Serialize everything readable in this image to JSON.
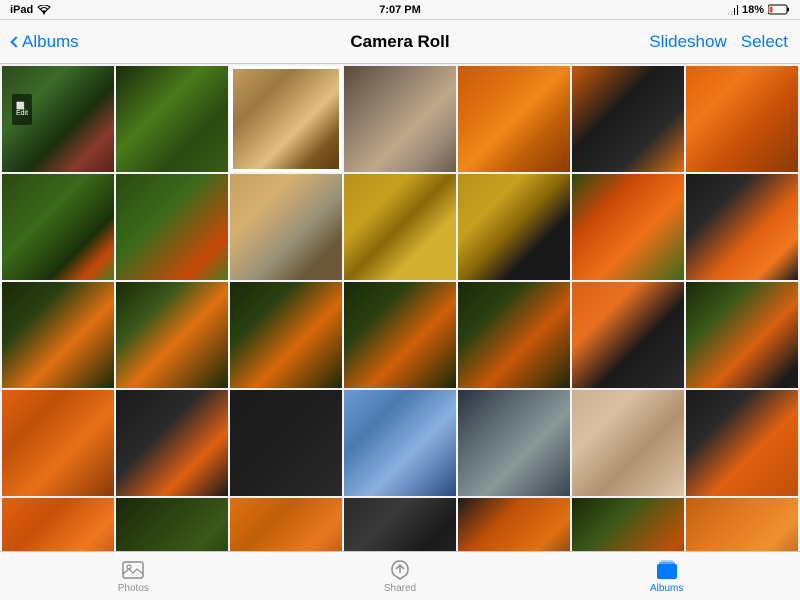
{
  "statusBar": {
    "carrier": "iPad",
    "wifi": "WiFi",
    "time": "7:07 PM",
    "battery": "18%",
    "batteryIcon": "battery-icon"
  },
  "navBar": {
    "backLabel": "Albums",
    "title": "Camera Roll",
    "slideshowLabel": "Slideshow",
    "selectLabel": "Select"
  },
  "tabs": [
    {
      "id": "photos",
      "label": "Photos",
      "active": false
    },
    {
      "id": "shared",
      "label": "Shared",
      "active": false
    },
    {
      "id": "albums",
      "label": "Albums",
      "active": true
    }
  ],
  "grid": {
    "rows": [
      [
        "t1-1",
        "t1-2",
        "t1-3",
        "t1-4",
        "t1-5",
        "t1-6",
        "t1-7"
      ],
      [
        "t2-1",
        "t2-2",
        "t2-3",
        "t2-4",
        "t2-5",
        "t2-6",
        "t2-7"
      ],
      [
        "t3-1",
        "t3-2",
        "t3-3",
        "t3-4",
        "t3-5",
        "t3-6",
        "t3-7"
      ],
      [
        "t4-1",
        "t4-2",
        "t4-3",
        "t4-4",
        "t4-5",
        "t4-6",
        "t4-7"
      ],
      [
        "t5-1",
        "t5-2",
        "t5-3",
        "t5-4",
        "t5-5",
        "t5-6",
        "t5-7"
      ]
    ]
  }
}
